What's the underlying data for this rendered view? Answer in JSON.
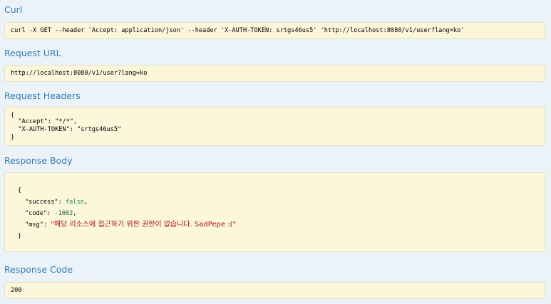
{
  "sections": {
    "curl": {
      "title": "Curl",
      "command": "curl -X GET --header 'Accept: application/json' --header 'X-AUTH-TOKEN: srtgs46us5' 'http://localhost:8080/v1/user?lang=ko'"
    },
    "request_url": {
      "title": "Request URL",
      "url": "http://localhost:8080/v1/user?lang=ko"
    },
    "request_headers": {
      "title": "Request Headers",
      "open_brace": "{",
      "line1": "  \"Accept\": \"*/*\",",
      "line2": "  \"X-AUTH-TOKEN\": \"srtgs46us5\"",
      "close_brace": "}"
    },
    "response_body": {
      "title": "Response Body",
      "open_brace": "{",
      "success_key": "\"success\"",
      "success_value": "false",
      "code_key": "\"code\"",
      "code_value": "-1002",
      "msg_key": "\"msg\"",
      "msg_value": "\"해당 리소스에 접근하기 위한 권한이 없습니다. SadPepe :(\"",
      "close_brace": "}"
    },
    "response_code": {
      "title": "Response Code",
      "code": "200"
    }
  },
  "colors": {
    "background": "#ebf3f9",
    "title": "#2f7cb8",
    "box_background": "#fcf6db",
    "string": "#a11",
    "boolean": "#219161",
    "number": "#164"
  }
}
